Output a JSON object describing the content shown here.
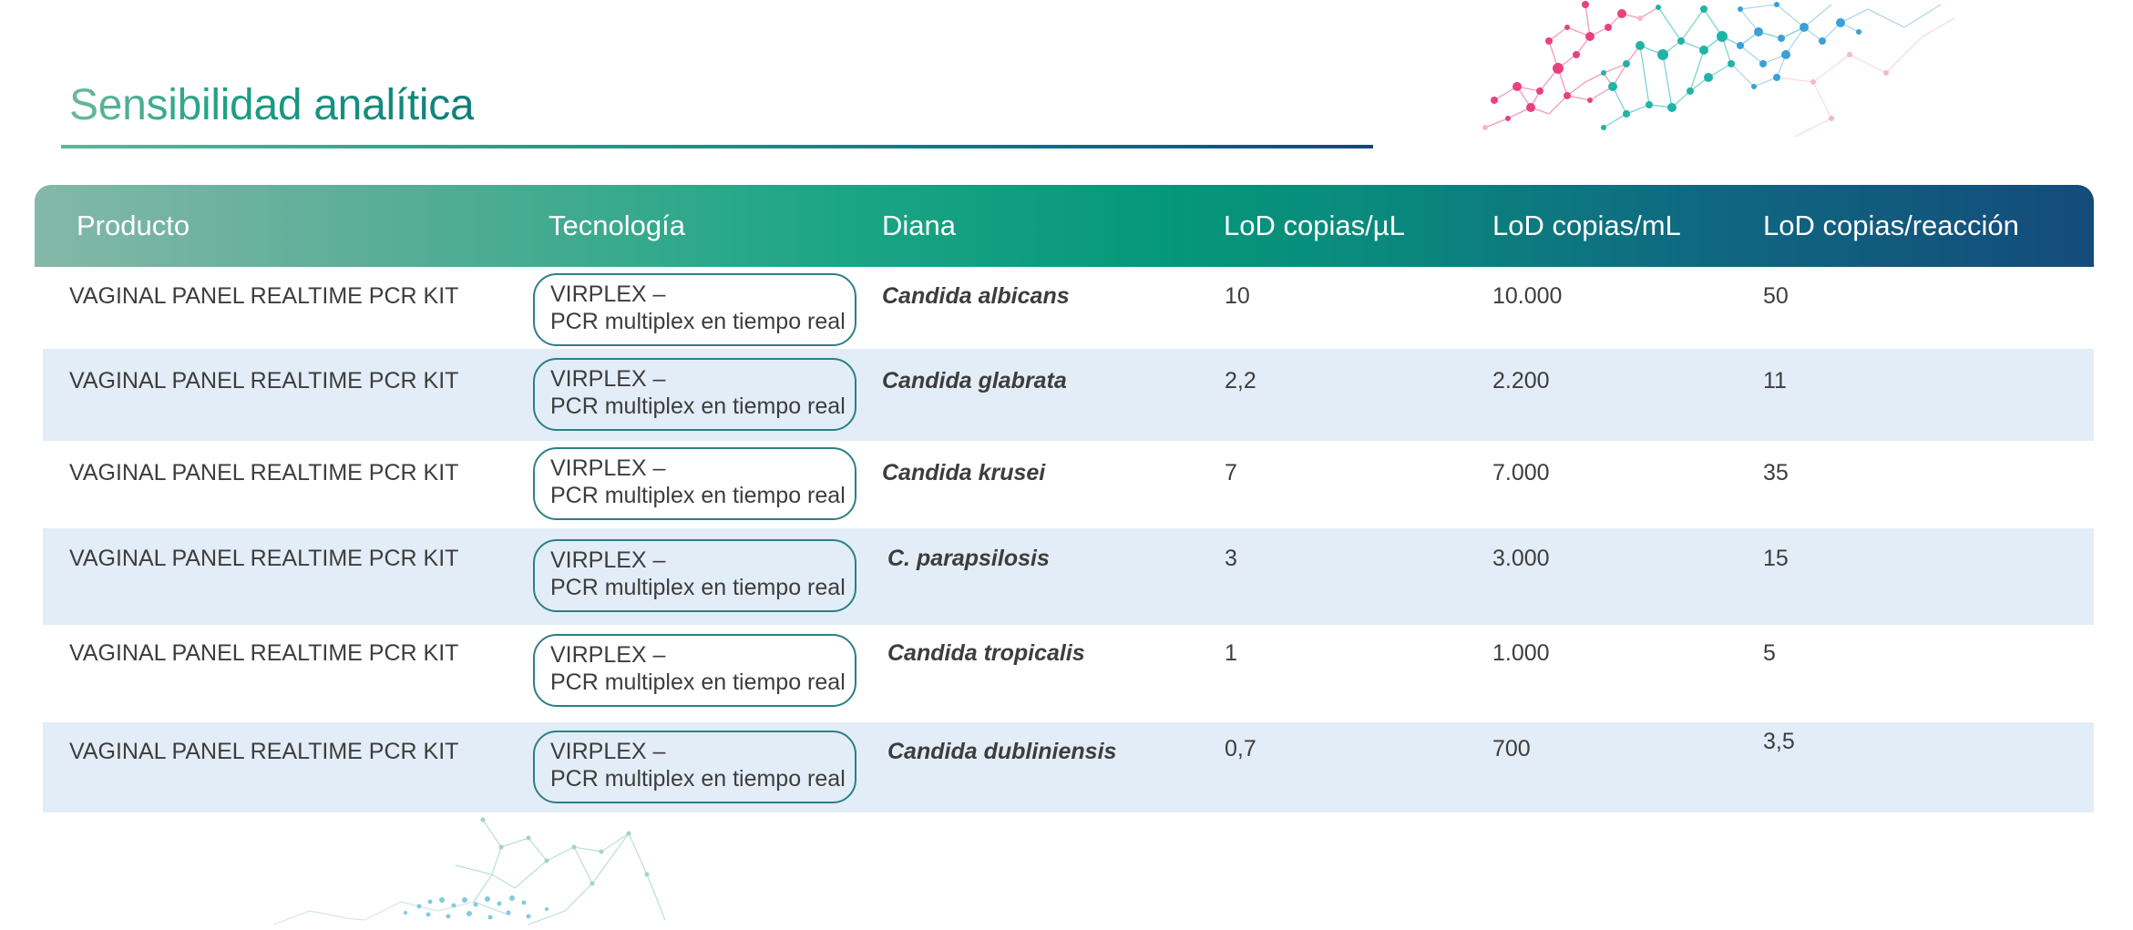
{
  "title": "Sensibilidad analítica",
  "columns": [
    "Producto",
    "Tecnología",
    "Diana",
    "LoD copias/µL",
    "LoD copias/mL",
    "LoD copias/reacción"
  ],
  "rows": [
    {
      "product": "VAGINAL PANEL REALTIME PCR KIT",
      "tech_line1": "VIRPLEX –",
      "tech_line2": "PCR multiplex en tiempo real",
      "target": "Candida albicans",
      "lod_ul": "10",
      "lod_ml": "10.000",
      "lod_rxn": "50"
    },
    {
      "product": "VAGINAL PANEL REALTIME PCR KIT",
      "tech_line1": "VIRPLEX –",
      "tech_line2": "PCR multiplex en tiempo real",
      "target": "Candida glabrata",
      "lod_ul": "2,2",
      "lod_ml": "2.200",
      "lod_rxn": "11"
    },
    {
      "product": "VAGINAL PANEL REALTIME PCR KIT",
      "tech_line1": "VIRPLEX –",
      "tech_line2": "PCR multiplex en tiempo real",
      "target": "Candida krusei",
      "lod_ul": "7",
      "lod_ml": "7.000",
      "lod_rxn": "35"
    },
    {
      "product": "VAGINAL PANEL REALTIME PCR KIT",
      "tech_line1": "VIRPLEX –",
      "tech_line2": "PCR multiplex en tiempo real",
      "target": "C. parapsilosis",
      "lod_ul": "3",
      "lod_ml": "3.000",
      "lod_rxn": "15"
    },
    {
      "product": "VAGINAL PANEL REALTIME PCR KIT",
      "tech_line1": "VIRPLEX –",
      "tech_line2": "PCR multiplex en tiempo real",
      "target": "Candida tropicalis",
      "lod_ul": "1",
      "lod_ml": "1.000",
      "lod_rxn": "5"
    },
    {
      "product": "VAGINAL PANEL REALTIME PCR KIT",
      "tech_line1": "VIRPLEX –",
      "tech_line2": "PCR multiplex en tiempo real",
      "target": "Candida dubliniensis",
      "lod_ul": "0,7",
      "lod_ml": "700",
      "lod_rxn": "3,5"
    }
  ],
  "colors": {
    "title_green": "#1a9f84",
    "header_start": "#84b8a8",
    "header_mid": "#05977a",
    "header_end": "#144b7b",
    "row_alt": "#e2edf7",
    "pill_border": "#2d7f86",
    "network_pink": "#e8417e",
    "network_teal": "#21b3a8",
    "network_blue": "#3aa0d8"
  },
  "icons": [
    "molecular-network-decoration"
  ]
}
